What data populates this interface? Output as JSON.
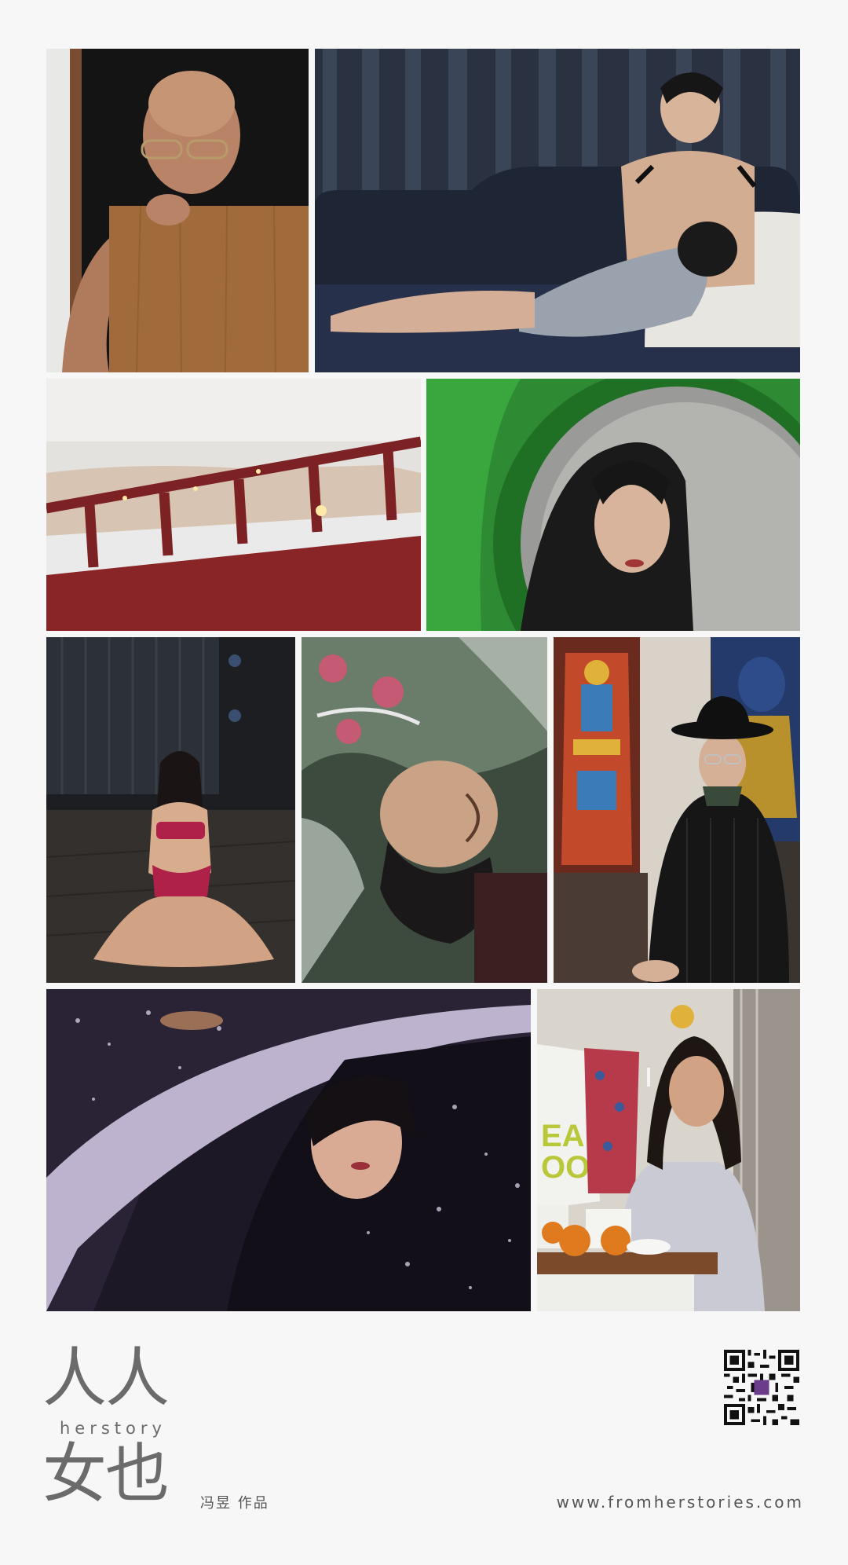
{
  "brand": {
    "title_top": "人人",
    "subtitle": "herstory",
    "title_bottom": "女也",
    "author": "冯昱 作品"
  },
  "website": "www.fromherstories.com",
  "photos": [
    {
      "id": "photo-bald-woman-glasses"
    },
    {
      "id": "photo-mother-breastfeeding-sofa"
    },
    {
      "id": "photo-woman-lying-bunk-bed"
    },
    {
      "id": "photo-woman-reflection-green-ring"
    },
    {
      "id": "photo-woman-red-swimsuit-kneeling"
    },
    {
      "id": "photo-woman-upside-down-floral"
    },
    {
      "id": "photo-person-black-hat-statues"
    },
    {
      "id": "photo-woman-car-window-rain"
    },
    {
      "id": "photo-woman-smoking-kitchen"
    }
  ],
  "colors": {
    "background": "#f7f7f7",
    "text": "#6b6b6b"
  },
  "icons": {
    "qr": "qr-code-icon"
  }
}
